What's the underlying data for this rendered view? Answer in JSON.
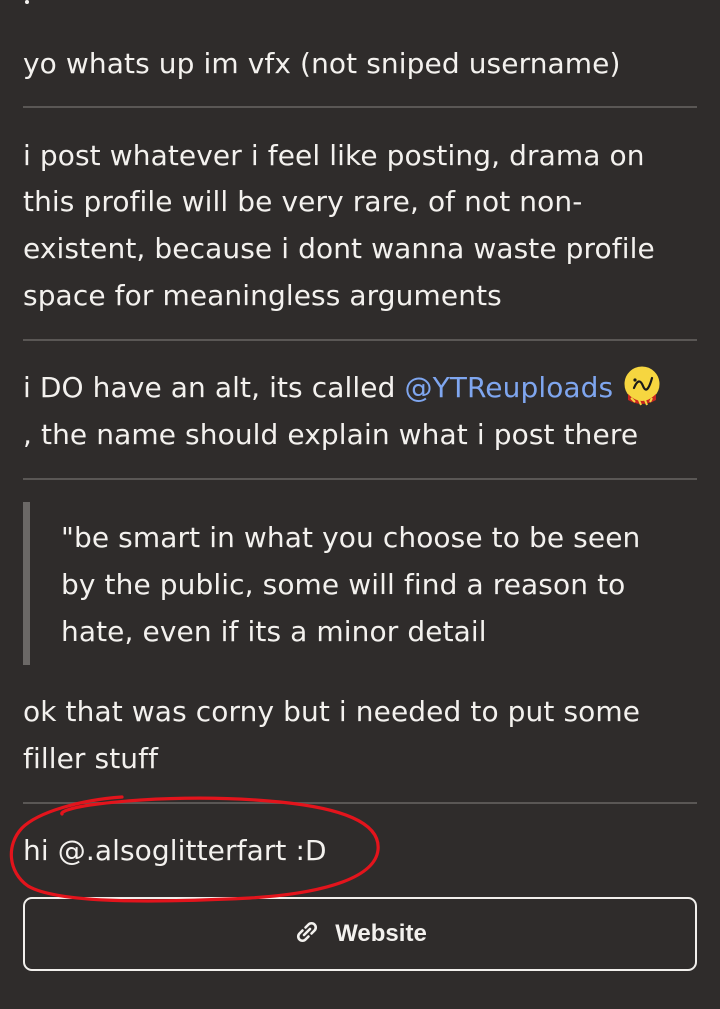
{
  "bio": {
    "line1": "yo whats up im vfx (not sniped username)",
    "para2": [
      "i post whatever i feel like posting, drama on",
      "this profile will be very rare, of not non-",
      "existent, because i dont wanna waste profile",
      "space for meaningless arguments"
    ],
    "alt_prefix": "i DO have an alt, its called ",
    "alt_mention": "@YTReuploads",
    "alt_suffix": ", the name should explain what i post there",
    "quote": [
      "\"be smart in what you choose to be seen",
      "by the public, some will find a reason to",
      "hate, even if its a minor detail"
    ],
    "filler": [
      "ok that was corny but i needed to put some",
      "filler stuff"
    ],
    "greeting": "hi @.alsoglitterfart :D"
  },
  "website_button": {
    "label": "Website",
    "icon": "link-icon"
  },
  "colors": {
    "background": "#2f2c2b",
    "text": "#f3f1ee",
    "mention": "#7fa6ef",
    "annotation": "#e3141c"
  }
}
